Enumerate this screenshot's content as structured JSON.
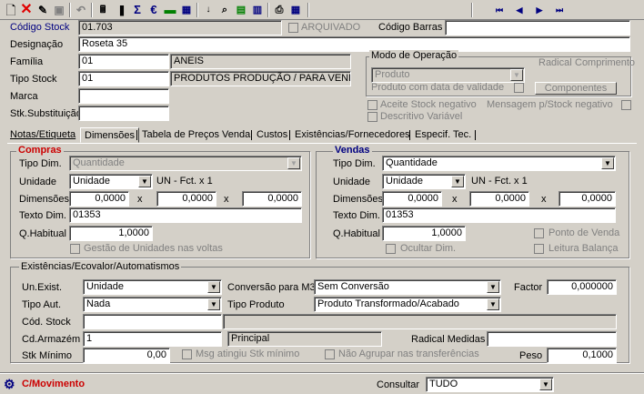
{
  "toolbar": {
    "new_icon": "new-document-icon",
    "delete_icon": "delete-icon",
    "edit_icon": "edit-icon",
    "save_icon": "save-icon",
    "undo_icon": "undo-icon",
    "nav_first": "⏮",
    "nav_prev": "◀",
    "nav_next": "▶",
    "nav_last": "⏭"
  },
  "header": {
    "codigo_stock_label": "Código Stock",
    "codigo_stock_value": "01.703",
    "arquivado_label": "ARQUIVADO",
    "codigo_barras_label": "Código Barras",
    "codigo_barras_value": "",
    "designacao_label": "Designação",
    "designacao_value": "Roseta 35",
    "familia_label": "Família",
    "familia_code": "01",
    "familia_desc": "ANEIS",
    "tipo_stock_label": "Tipo Stock",
    "tipo_stock_code": "01",
    "tipo_stock_desc": "PRODUTOS PRODUÇÃO / PARA VENDA",
    "marca_label": "Marca",
    "marca_value": "",
    "stk_subst_label": "Stk.Substituição",
    "stk_subst_value": ""
  },
  "modo_operacao": {
    "title": "Modo de Operação",
    "radical_label": "Radical",
    "comprimento_label": "Comprimento",
    "select_value": "Produto",
    "validade_label": "Produto com data de validade",
    "componentes_button": "Componentes",
    "aceite_label": "Aceite Stock negativo",
    "mensagem_label": "Mensagem p/Stock negativo",
    "descritivo_label": "Descritivo Variável"
  },
  "tabs": [
    {
      "label": "Notas/Etiqueta"
    },
    {
      "label": "Dimensões"
    },
    {
      "label": "Tabela de Preços Venda"
    },
    {
      "label": "Custos"
    },
    {
      "label": "Existências/Fornecedores"
    },
    {
      "label": "Especif. Tec."
    }
  ],
  "compras": {
    "title": "Compras",
    "tipo_dim_label": "Tipo Dim.",
    "tipo_dim_value": "Quantidade",
    "unidade_label": "Unidade",
    "unidade_value": "Unidade",
    "fct": "UN - Fct. x 1",
    "dimensoes_label": "Dimensões",
    "dim1": "0,0000",
    "dim2": "0,0000",
    "dim3": "0,0000",
    "x": "x",
    "texto_dim_label": "Texto Dim.",
    "texto_dim_value": "01353",
    "qhabitual_label": "Q.Habitual",
    "qhabitual_value": "1,0000",
    "gestao_label": "Gestão de Unidades nas voltas"
  },
  "vendas": {
    "title": "Vendas",
    "tipo_dim_label": "Tipo Dim.",
    "tipo_dim_value": "Quantidade",
    "unidade_label": "Unidade",
    "unidade_value": "Unidade",
    "fct": "UN - Fct. x 1",
    "dimensoes_label": "Dimensões",
    "dim1": "0,0000",
    "dim2": "0,0000",
    "dim3": "0,0000",
    "x": "x",
    "texto_dim_label": "Texto Dim.",
    "texto_dim_value": "01353",
    "qhabitual_label": "Q.Habitual",
    "qhabitual_value": "1,0000",
    "ponto_venda_label": "Ponto de Venda",
    "ocultar_label": "Ocultar Dim.",
    "leitura_label": "Leitura Balança"
  },
  "existencias": {
    "title": "Existências/Ecovalor/Automatismos",
    "un_exist_label": "Un.Exist.",
    "un_exist_value": "Unidade",
    "conversao_label": "Conversão para M3",
    "conversao_value": "Sem Conversão",
    "factor_label": "Factor",
    "factor_value": "0,000000",
    "tipo_aut_label": "Tipo Aut.",
    "tipo_aut_value": "Nada",
    "tipo_produto_label": "Tipo Produto",
    "tipo_produto_value": "Produto Transformado/Acabado",
    "cod_stock_label": "Cód. Stock",
    "cod_stock_value": "",
    "cd_armazem_label": "Cd.Armazém",
    "cd_armazem_value": "1",
    "armazem_desc": "Principal",
    "radical_medidas_label": "Radical Medidas",
    "radical_medidas_value": "",
    "stk_minimo_label": "Stk Mínimo",
    "stk_minimo_value": "0,00",
    "msg_label": "Msg atingiu Stk mínimo",
    "nao_agrupar_label": "Não Agrupar nas transferências",
    "peso_label": "Peso",
    "peso_value": "0,1000"
  },
  "status": {
    "movimento": "C/Movimento",
    "consultar_label": "Consultar",
    "consultar_value": "TUDO"
  },
  "colors": {
    "accent": "#000080",
    "red": "#cc0000",
    "face": "#d4d0c8"
  }
}
